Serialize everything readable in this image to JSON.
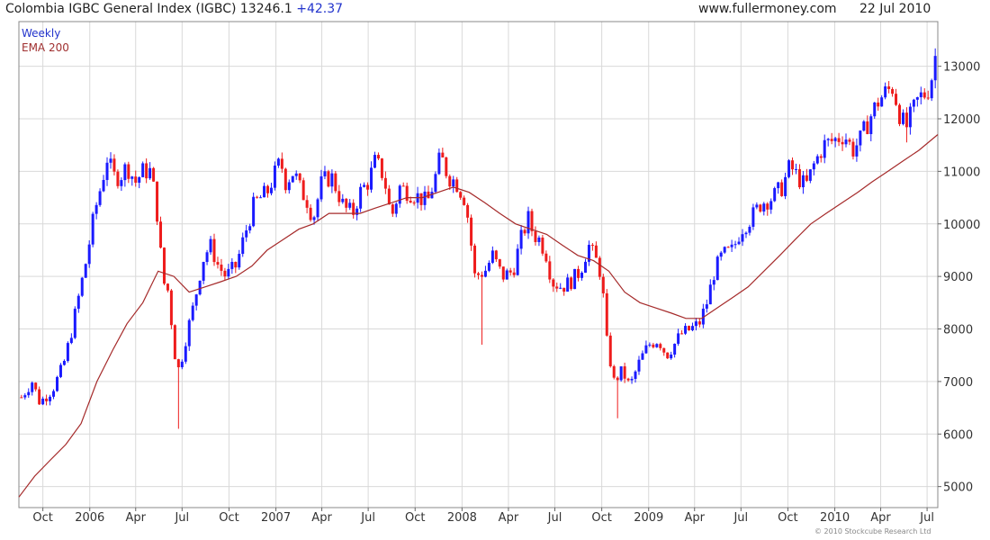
{
  "header": {
    "title": "Colombia IGBC General Index (IGBC) 13246.1",
    "change": "+42.37",
    "site": "www.fullermoney.com",
    "date": "22 Jul 2010"
  },
  "legend": {
    "weekly": "Weekly",
    "ema": "EMA 200"
  },
  "copyright": "© 2010 Stockcube Research Ltd",
  "colors": {
    "up": "#1a1aff",
    "down": "#ee1c1c",
    "ema": "#a52a2a",
    "grid": "#d9d9d9",
    "frame": "#888888"
  },
  "chart_data": {
    "type": "candlestick",
    "title": "Colombia IGBC General Index (IGBC) 13246.1 +42.37",
    "xlabel": "",
    "ylabel": "",
    "x_range": [
      "2005-08-15",
      "2010-07-22"
    ],
    "ylim": [
      4600,
      13850
    ],
    "y_axis_position": "right",
    "y_ticks": [
      5000,
      6000,
      7000,
      8000,
      9000,
      10000,
      11000,
      12000,
      13000
    ],
    "x_ticks": [
      {
        "label": "Oct",
        "date": "2005-10-01"
      },
      {
        "label": "2006",
        "date": "2006-01-01"
      },
      {
        "label": "Apr",
        "date": "2006-04-01"
      },
      {
        "label": "Jul",
        "date": "2006-07-01"
      },
      {
        "label": "Oct",
        "date": "2006-10-01"
      },
      {
        "label": "2007",
        "date": "2007-01-01"
      },
      {
        "label": "Apr",
        "date": "2007-04-01"
      },
      {
        "label": "Jul",
        "date": "2007-07-01"
      },
      {
        "label": "Oct",
        "date": "2007-10-01"
      },
      {
        "label": "2008",
        "date": "2008-01-01"
      },
      {
        "label": "Apr",
        "date": "2008-04-01"
      },
      {
        "label": "Jul",
        "date": "2008-07-01"
      },
      {
        "label": "Oct",
        "date": "2008-10-01"
      },
      {
        "label": "2009",
        "date": "2009-01-01"
      },
      {
        "label": "Apr",
        "date": "2009-04-01"
      },
      {
        "label": "Jul",
        "date": "2009-07-01"
      },
      {
        "label": "Oct",
        "date": "2009-10-01"
      },
      {
        "label": "2010",
        "date": "2010-01-01"
      },
      {
        "label": "Apr",
        "date": "2010-04-01"
      },
      {
        "label": "Jul",
        "date": "2010-07-01"
      }
    ],
    "grid": true,
    "legend_position": "top-left",
    "series": [
      {
        "name": "Weekly",
        "style": "candles",
        "close_path": [
          [
            "2005-08-20",
            6700
          ],
          [
            "2005-09-10",
            7000
          ],
          [
            "2005-09-25",
            6600
          ],
          [
            "2005-10-20",
            6850
          ],
          [
            "2005-11-10",
            7300
          ],
          [
            "2005-11-25",
            7900
          ],
          [
            "2005-12-10",
            8600
          ],
          [
            "2005-12-25",
            9300
          ],
          [
            "2006-01-10",
            10200
          ],
          [
            "2006-01-25",
            10800
          ],
          [
            "2006-02-05",
            11300
          ],
          [
            "2006-02-15",
            10900
          ],
          [
            "2006-03-01",
            10900
          ],
          [
            "2006-03-15",
            11100
          ],
          [
            "2006-04-01",
            10800
          ],
          [
            "2006-04-15",
            11000
          ],
          [
            "2006-05-01",
            11000
          ],
          [
            "2006-05-12",
            10300
          ],
          [
            "2006-05-25",
            8900
          ],
          [
            "2006-06-05",
            8700
          ],
          [
            "2006-06-15",
            7600
          ],
          [
            "2006-06-25",
            7200
          ],
          [
            "2006-07-10",
            7900
          ],
          [
            "2006-07-25",
            8500
          ],
          [
            "2006-08-10",
            9300
          ],
          [
            "2006-08-25",
            9600
          ],
          [
            "2006-09-10",
            9200
          ],
          [
            "2006-09-25",
            9000
          ],
          [
            "2006-10-15",
            9200
          ],
          [
            "2006-11-01",
            9800
          ],
          [
            "2006-11-20",
            10400
          ],
          [
            "2006-12-15",
            10600
          ],
          [
            "2007-01-01",
            11000
          ],
          [
            "2007-01-10",
            11200
          ],
          [
            "2007-01-20",
            10800
          ],
          [
            "2007-02-05",
            11000
          ],
          [
            "2007-02-20",
            10600
          ],
          [
            "2007-03-01",
            10500
          ],
          [
            "2007-03-15",
            10100
          ],
          [
            "2007-04-01",
            10800
          ],
          [
            "2007-04-20",
            10900
          ],
          [
            "2007-05-15",
            10300
          ],
          [
            "2007-06-01",
            10200
          ],
          [
            "2007-06-15",
            10600
          ],
          [
            "2007-07-01",
            10800
          ],
          [
            "2007-07-15",
            11200
          ],
          [
            "2007-08-01",
            10900
          ],
          [
            "2007-08-15",
            10100
          ],
          [
            "2007-09-01",
            10700
          ],
          [
            "2007-09-20",
            10600
          ],
          [
            "2007-10-10",
            10500
          ],
          [
            "2007-10-25",
            10400
          ],
          [
            "2007-11-10",
            10900
          ],
          [
            "2007-11-20",
            11300
          ],
          [
            "2007-12-05",
            10900
          ],
          [
            "2007-12-20",
            10800
          ],
          [
            "2008-01-05",
            10500
          ],
          [
            "2008-01-15",
            10000
          ],
          [
            "2008-01-25",
            9000
          ],
          [
            "2008-02-15",
            9100
          ],
          [
            "2008-03-01",
            9400
          ],
          [
            "2008-03-20",
            9000
          ],
          [
            "2008-04-10",
            9100
          ],
          [
            "2008-04-25",
            9700
          ],
          [
            "2008-05-10",
            10100
          ],
          [
            "2008-05-20",
            9800
          ],
          [
            "2008-06-01",
            9700
          ],
          [
            "2008-06-15",
            9400
          ],
          [
            "2008-06-25",
            8900
          ],
          [
            "2008-07-15",
            8800
          ],
          [
            "2008-08-01",
            8900
          ],
          [
            "2008-08-20",
            9100
          ],
          [
            "2008-09-05",
            9600
          ],
          [
            "2008-09-20",
            9300
          ],
          [
            "2008-10-01",
            9000
          ],
          [
            "2008-10-10",
            7800
          ],
          [
            "2008-10-25",
            7000
          ],
          [
            "2008-11-10",
            7200
          ],
          [
            "2008-11-25",
            6900
          ],
          [
            "2008-12-15",
            7400
          ],
          [
            "2009-01-01",
            7700
          ],
          [
            "2009-01-20",
            7800
          ],
          [
            "2009-02-05",
            7500
          ],
          [
            "2009-02-20",
            7700
          ],
          [
            "2009-03-05",
            7900
          ],
          [
            "2009-03-25",
            8000
          ],
          [
            "2009-04-10",
            8100
          ],
          [
            "2009-04-25",
            8500
          ],
          [
            "2009-05-10",
            9100
          ],
          [
            "2009-05-25",
            9400
          ],
          [
            "2009-06-15",
            9500
          ],
          [
            "2009-07-01",
            9900
          ],
          [
            "2009-07-20",
            10100
          ],
          [
            "2009-08-10",
            10400
          ],
          [
            "2009-09-01",
            10500
          ],
          [
            "2009-09-20",
            10700
          ],
          [
            "2009-10-05",
            11100
          ],
          [
            "2009-10-20",
            10900
          ],
          [
            "2009-11-05",
            10700
          ],
          [
            "2009-11-20",
            11100
          ],
          [
            "2009-12-10",
            11500
          ],
          [
            "2010-01-01",
            11600
          ],
          [
            "2010-01-20",
            11700
          ],
          [
            "2010-02-05",
            11400
          ],
          [
            "2010-02-20",
            11600
          ],
          [
            "2010-03-10",
            12000
          ],
          [
            "2010-03-25",
            12300
          ],
          [
            "2010-04-10",
            12500
          ],
          [
            "2010-04-25",
            12600
          ],
          [
            "2010-05-08",
            12100
          ],
          [
            "2010-05-20",
            11800
          ],
          [
            "2010-06-01",
            12100
          ],
          [
            "2010-06-15",
            12400
          ],
          [
            "2010-07-01",
            12500
          ],
          [
            "2010-07-10",
            12800
          ],
          [
            "2010-07-18",
            13246
          ]
        ],
        "marked_wicks": [
          {
            "date": "2006-06-25",
            "low": 6100
          },
          {
            "date": "2008-02-10",
            "low": 7700
          },
          {
            "date": "2008-11-01",
            "low": 6300
          },
          {
            "date": "2010-05-20",
            "low": 11550
          }
        ]
      },
      {
        "name": "EMA 200",
        "style": "line",
        "points": [
          [
            "2005-08-15",
            4800
          ],
          [
            "2005-09-15",
            5200
          ],
          [
            "2005-10-15",
            5500
          ],
          [
            "2005-11-15",
            5800
          ],
          [
            "2005-12-15",
            6200
          ],
          [
            "2006-01-15",
            7000
          ],
          [
            "2006-02-15",
            7600
          ],
          [
            "2006-03-15",
            8100
          ],
          [
            "2006-04-15",
            8500
          ],
          [
            "2006-05-15",
            9100
          ],
          [
            "2006-06-15",
            9000
          ],
          [
            "2006-07-15",
            8700
          ],
          [
            "2006-08-15",
            8800
          ],
          [
            "2006-09-15",
            8900
          ],
          [
            "2006-10-15",
            9000
          ],
          [
            "2006-11-15",
            9200
          ],
          [
            "2006-12-15",
            9500
          ],
          [
            "2007-01-15",
            9700
          ],
          [
            "2007-02-15",
            9900
          ],
          [
            "2007-03-15",
            10000
          ],
          [
            "2007-04-15",
            10200
          ],
          [
            "2007-05-15",
            10200
          ],
          [
            "2007-06-15",
            10200
          ],
          [
            "2007-07-15",
            10300
          ],
          [
            "2007-08-15",
            10400
          ],
          [
            "2007-09-15",
            10500
          ],
          [
            "2007-10-15",
            10500
          ],
          [
            "2007-11-15",
            10600
          ],
          [
            "2007-12-15",
            10700
          ],
          [
            "2008-01-15",
            10600
          ],
          [
            "2008-02-15",
            10400
          ],
          [
            "2008-03-15",
            10200
          ],
          [
            "2008-04-15",
            10000
          ],
          [
            "2008-05-15",
            9900
          ],
          [
            "2008-06-15",
            9800
          ],
          [
            "2008-07-15",
            9600
          ],
          [
            "2008-08-15",
            9400
          ],
          [
            "2008-09-15",
            9300
          ],
          [
            "2008-10-15",
            9100
          ],
          [
            "2008-11-15",
            8700
          ],
          [
            "2008-12-15",
            8500
          ],
          [
            "2009-01-15",
            8400
          ],
          [
            "2009-02-15",
            8300
          ],
          [
            "2009-03-15",
            8200
          ],
          [
            "2009-04-15",
            8200
          ],
          [
            "2009-05-15",
            8400
          ],
          [
            "2009-06-15",
            8600
          ],
          [
            "2009-07-15",
            8800
          ],
          [
            "2009-08-15",
            9100
          ],
          [
            "2009-09-15",
            9400
          ],
          [
            "2009-10-15",
            9700
          ],
          [
            "2009-11-15",
            10000
          ],
          [
            "2009-12-15",
            10200
          ],
          [
            "2010-01-15",
            10400
          ],
          [
            "2010-02-15",
            10600
          ],
          [
            "2010-03-15",
            10800
          ],
          [
            "2010-04-15",
            11000
          ],
          [
            "2010-05-15",
            11200
          ],
          [
            "2010-06-15",
            11400
          ],
          [
            "2010-07-22",
            11700
          ]
        ]
      }
    ]
  }
}
